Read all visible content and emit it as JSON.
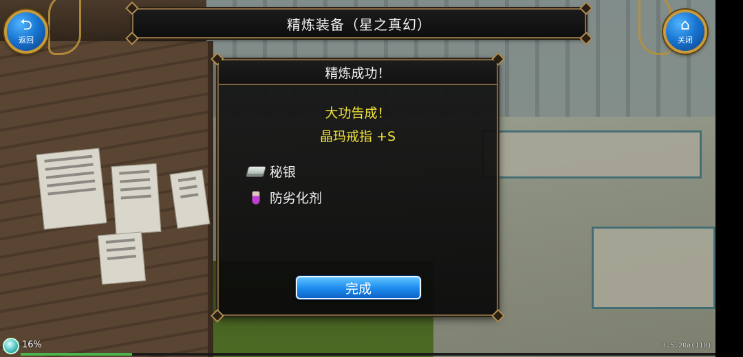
{
  "title_bar": {
    "title": "精炼装备（星之真幻）"
  },
  "buttons": {
    "back": {
      "icon": "return-arrow-icon",
      "label": "返回"
    },
    "close": {
      "icon": "home-icon",
      "label": "关闭"
    }
  },
  "dialog": {
    "title": "精炼成功！",
    "message_line1": "大功告成！",
    "message_line2": "晶玛戒指 +S",
    "materials": [
      {
        "icon": "silver-ingot-icon",
        "label": "秘银"
      },
      {
        "icon": "potion-icon",
        "label": "防劣化剂"
      }
    ],
    "done_label": "完成"
  },
  "status": {
    "progress_text": "16%",
    "progress_fraction": 0.16,
    "version": "3.5.20a(110)"
  },
  "colors": {
    "message_yellow": "#f2e23a",
    "button_blue": "#1f8ef0",
    "frame_gold": "#7c6440"
  }
}
